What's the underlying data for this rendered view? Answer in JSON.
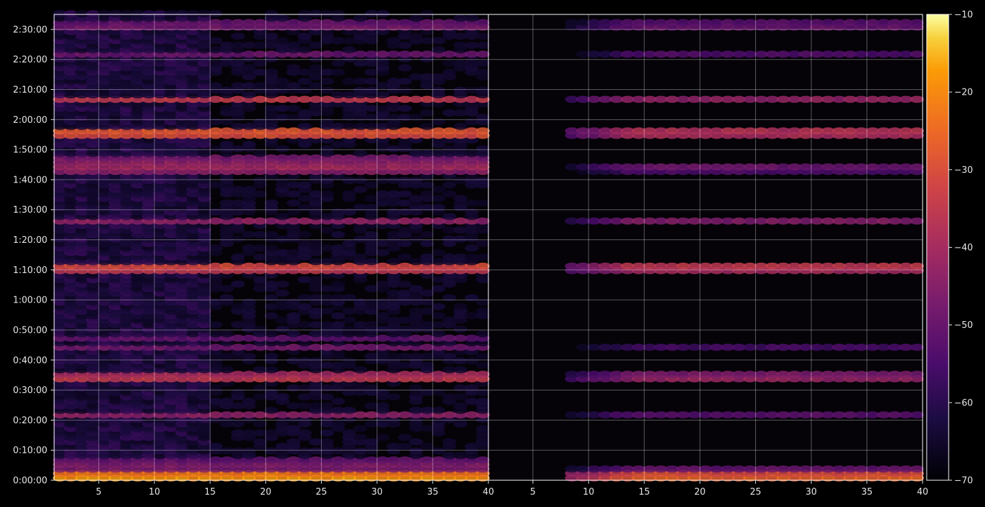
{
  "chart_data": {
    "type": "heatmap",
    "title": "",
    "xlabel": "",
    "ylabel": "",
    "panels": [
      {
        "name": "",
        "xlim": [
          1,
          40
        ],
        "xticks": [
          5,
          10,
          15,
          20,
          25,
          30,
          35,
          40
        ],
        "xtick_labels": [
          "5",
          "10",
          "15",
          "20",
          "25",
          "30",
          "35",
          "40"
        ]
      },
      {
        "name": "",
        "xlim": [
          1,
          40
        ],
        "xticks": [
          5,
          10,
          15,
          20,
          25,
          30,
          35,
          40
        ],
        "xtick_labels": [
          "5",
          "10",
          "15",
          "20",
          "25",
          "30",
          "35",
          "40"
        ]
      }
    ],
    "ylim_seconds": [
      0,
      9300
    ],
    "yticks_seconds": [
      0,
      600,
      1200,
      1800,
      2400,
      3000,
      3600,
      4200,
      4800,
      5400,
      6000,
      6600,
      7200,
      7800,
      8400,
      9000
    ],
    "ytick_labels": [
      "0:00:00",
      "0:10:00",
      "0:20:00",
      "0:30:00",
      "0:40:00",
      "0:50:00",
      "1:00:00",
      "1:10:00",
      "1:20:00",
      "1:30:00",
      "1:40:00",
      "1:50:00",
      "2:00:00",
      "2:10:00",
      "2:20:00",
      "2:30:00"
    ],
    "colorbar": {
      "vmin": -70,
      "vmax": -10,
      "ticks": [
        -10,
        -20,
        -30,
        -40,
        -50,
        -60,
        -70
      ],
      "tick_labels": [
        "−10",
        "−20",
        "−30",
        "−40",
        "−50",
        "−60",
        "−70"
      ],
      "colormap": "inferno"
    },
    "grid": true,
    "bands_left": [
      {
        "t": 60,
        "level": -27
      },
      {
        "t": 170,
        "level": -48
      },
      {
        "t": 330,
        "level": -55
      },
      {
        "t": 1280,
        "level": -47
      },
      {
        "t": 2040,
        "level": -44
      },
      {
        "t": 2600,
        "level": -50
      },
      {
        "t": 2800,
        "level": -53
      },
      {
        "t": 4170,
        "level": -40
      },
      {
        "t": 5140,
        "level": -45
      },
      {
        "t": 6150,
        "level": -49
      },
      {
        "t": 6360,
        "level": -52
      },
      {
        "t": 6880,
        "level": -36
      },
      {
        "t": 7560,
        "level": -35
      },
      {
        "t": 8450,
        "level": -51
      },
      {
        "t": 9000,
        "level": -48
      },
      {
        "t": 9080,
        "level": -52
      }
    ],
    "bands_right": [
      {
        "t": 60,
        "level": -35
      },
      {
        "t": 170,
        "level": -52
      },
      {
        "t": 1280,
        "level": -55
      },
      {
        "t": 2040,
        "level": -51
      },
      {
        "t": 2600,
        "level": -57
      },
      {
        "t": 4170,
        "level": -44
      },
      {
        "t": 5140,
        "level": -47
      },
      {
        "t": 6150,
        "level": -58
      },
      {
        "t": 6880,
        "level": -45
      },
      {
        "t": 7560,
        "level": -43
      },
      {
        "t": 8450,
        "level": -55
      },
      {
        "t": 9000,
        "level": -50
      },
      {
        "t": 9080,
        "level": -54
      }
    ]
  }
}
